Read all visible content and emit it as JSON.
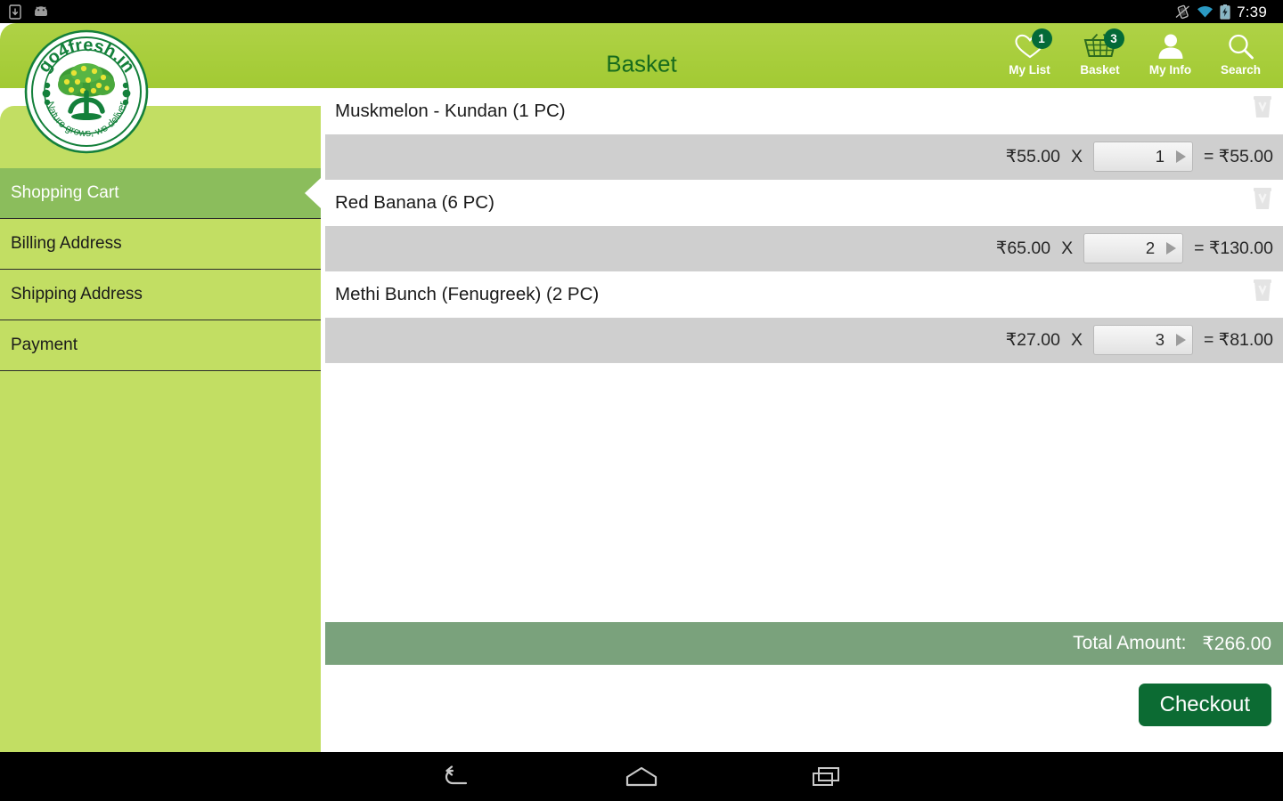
{
  "status_bar": {
    "left_icons": [
      "download-icon",
      "android-icon"
    ],
    "right_icons": [
      "vibrate-icon",
      "wifi-icon",
      "battery-charging-icon"
    ],
    "clock": "7:39"
  },
  "header": {
    "title": "Basket",
    "logo": {
      "brand": "go4fresh.in",
      "tagline": "Nature grows, we deliver"
    },
    "actions": [
      {
        "icon": "heart-icon",
        "label": "My List",
        "badge": "1"
      },
      {
        "icon": "basket-icon",
        "label": "Basket",
        "badge": "3"
      },
      {
        "icon": "person-icon",
        "label": "My Info",
        "badge": ""
      },
      {
        "icon": "search-icon",
        "label": "Search",
        "badge": ""
      }
    ]
  },
  "sidebar": {
    "items": [
      {
        "label": "Shopping Cart",
        "active": true
      },
      {
        "label": "Billing Address",
        "active": false
      },
      {
        "label": "Shipping Address",
        "active": false
      },
      {
        "label": "Payment",
        "active": false
      }
    ]
  },
  "cart": {
    "items": [
      {
        "name": "Muskmelon - Kundan (1 PC)",
        "unit_price": "₹55.00",
        "multiply_symbol": "X",
        "quantity": "1",
        "line_total": "= ₹55.00",
        "delete_icon": "trash-icon"
      },
      {
        "name": "Red Banana (6 PC)",
        "unit_price": "₹65.00",
        "multiply_symbol": "X",
        "quantity": "2",
        "line_total": "= ₹130.00",
        "delete_icon": "trash-icon"
      },
      {
        "name": "Methi Bunch (Fenugreek)  (2 PC)",
        "unit_price": "₹27.00",
        "multiply_symbol": "X",
        "quantity": "3",
        "line_total": "= ₹81.00",
        "delete_icon": "trash-icon"
      }
    ],
    "total_label": "Total Amount:",
    "total_value": "₹266.00",
    "checkout_label": "Checkout"
  },
  "nav_bar": {
    "buttons": [
      "back-icon",
      "home-icon",
      "recents-icon"
    ]
  },
  "colors": {
    "header_green": "#a9cf3e",
    "sidebar_green": "#c2de63",
    "active_green": "#8bbd5c",
    "badge_green": "#046a38",
    "total_bar_green": "#7aa27c",
    "checkout_green": "#0c6b33",
    "title_green": "#176b1d",
    "row_grey": "#cfcfcf"
  }
}
